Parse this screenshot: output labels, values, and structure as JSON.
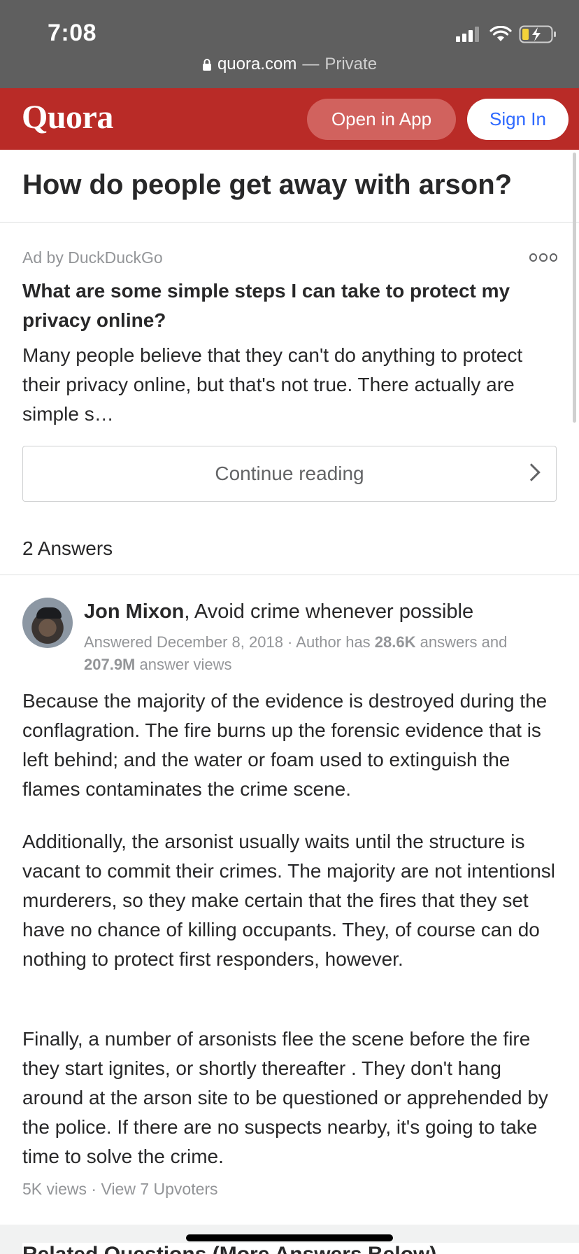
{
  "status_bar": {
    "time": "7:08",
    "url_domain": "quora.com",
    "url_separator": "—",
    "url_private": "Private"
  },
  "header": {
    "logo": "Quora",
    "open_in_app": "Open in App",
    "sign_in": "Sign In",
    "brand_color": "#b92b27"
  },
  "question": {
    "title": "How do people get away with arson?"
  },
  "ad": {
    "label": "Ad by DuckDuckGo",
    "title": "What are some simple steps I can take to protect my privacy online?",
    "body": "Many people believe that they can't do anything to protect their privacy online, but that's not true. There actually are simple s…",
    "continue_label": "Continue reading"
  },
  "answers": {
    "count_label": "2 Answers",
    "items": [
      {
        "author_name": "Jon Mixon",
        "author_credential": ", Avoid crime whenever possible",
        "meta_answered": "Answered December 8, 2018 · Author has ",
        "meta_answers_count": "28.6K",
        "meta_answers_word": " answers and ",
        "meta_views_count": "207.9M",
        "meta_views_word": " answer views",
        "paragraphs": [
          "Because the majority of the evidence is destroyed during the conflagration. The fire burns up the forensic evidence that is left behind; and the water or foam used to extinguish the flames contaminates the crime scene.",
          "Additionally, the arsonist usually waits until the structure is vacant to commit their crimes. The majority are not intentionsl murderers, so they make certain that the fires that they set have no chance of killing occupants. They, of course can do nothing to protect first responders, however.",
          "Finally, a number of arsonists flee the scene before the fire they start ignites, or shortly thereafter . They don't hang around at the arson site to be questioned or apprehended by the police. If there are no suspects nearby, it's going to take time to solve the crime."
        ],
        "views": "5K views",
        "stats_separator": " · ",
        "upvoters": "View 7 Upvoters"
      }
    ]
  },
  "related_peek": "Related Questions (More Answers Below)"
}
